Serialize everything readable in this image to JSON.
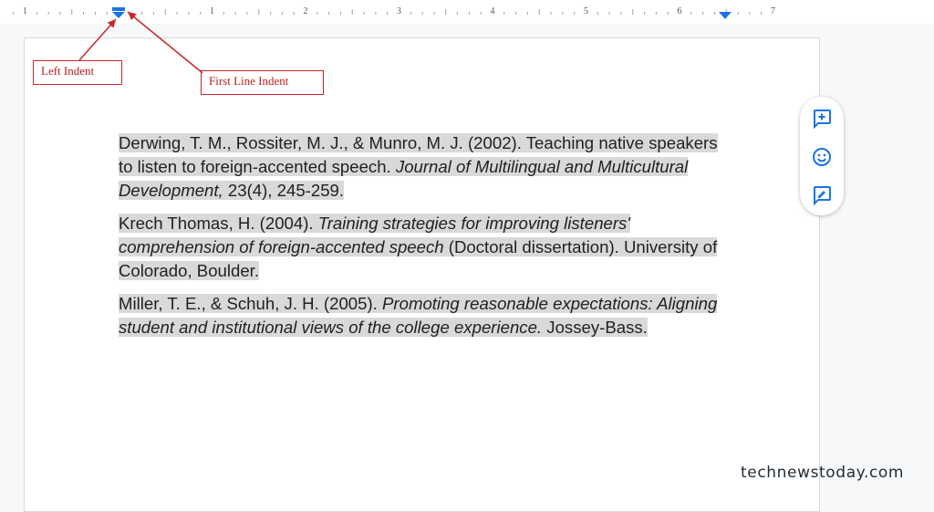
{
  "ruler": {
    "numbers": [
      "1",
      "1",
      "2",
      "3",
      "4",
      "5",
      "6",
      "7"
    ]
  },
  "annotations": {
    "left_indent": "Left Indent",
    "first_line_indent": "First Line Indent"
  },
  "references": [
    {
      "parts": [
        {
          "text": "Derwing, T. M., Rossiter, M. J., & Munro, M. J. (2002). Teaching native speakers to listen to foreign-accented speech. ",
          "italic": false
        },
        {
          "text": "Journal of Multilingual and Multicultural Development,",
          "italic": true
        },
        {
          "text": " 23(4), 245-259.",
          "italic": false
        }
      ]
    },
    {
      "parts": [
        {
          "text": "Krech Thomas, H. (2004). ",
          "italic": false
        },
        {
          "text": "Training strategies for improving listeners' comprehension of foreign-accented speech",
          "italic": true
        },
        {
          "text": " (Doctoral dissertation). University of Colorado, Boulder.",
          "italic": false
        }
      ]
    },
    {
      "parts": [
        {
          "text": "Miller, T. E., & Schuh, J. H. (2005). ",
          "italic": false
        },
        {
          "text": "Promoting reasonable expectations: Aligning student and institutional views of the college experience.",
          "italic": true
        },
        {
          "text": " Jossey-Bass.",
          "italic": false
        }
      ]
    }
  ],
  "side_toolbar": [
    {
      "name": "add-comment-icon"
    },
    {
      "name": "emoji-reaction-icon"
    },
    {
      "name": "suggest-edits-icon"
    }
  ],
  "watermark": "technewstoday.com",
  "colors": {
    "accent": "#1a73e8",
    "annotation": "#c62828",
    "highlight": "#d9d9d9"
  }
}
